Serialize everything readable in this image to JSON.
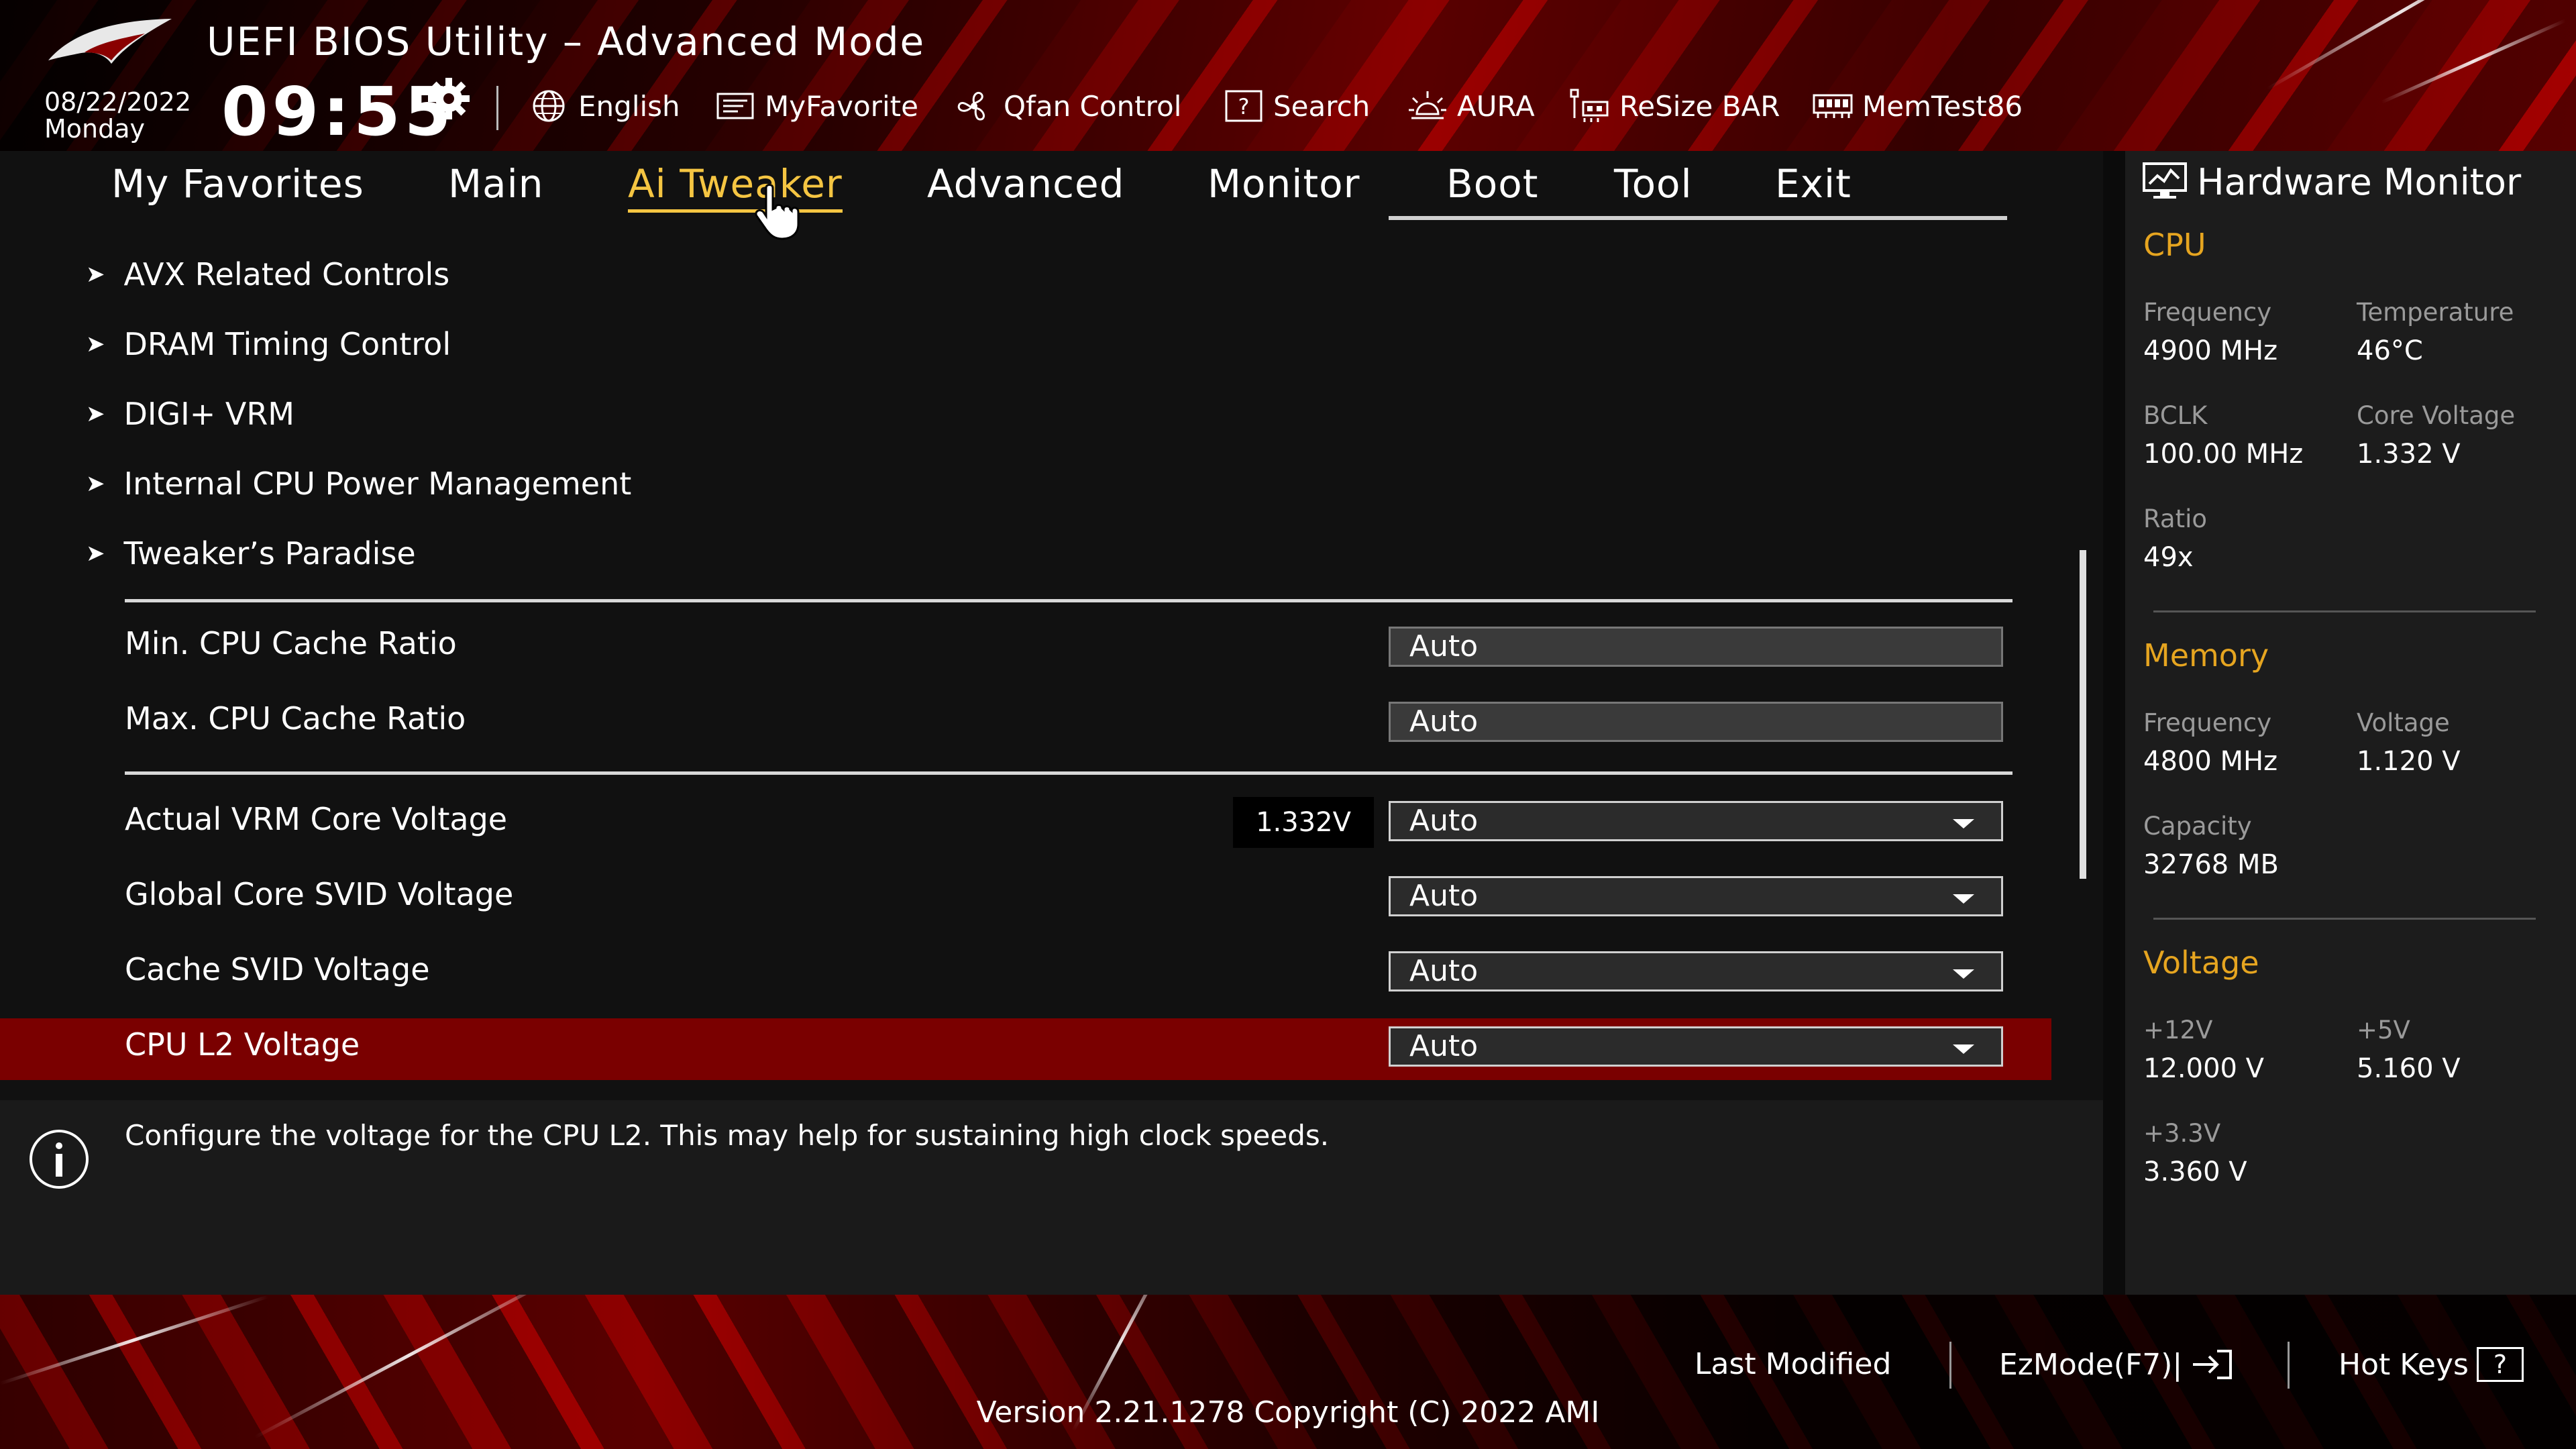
{
  "header": {
    "title": "UEFI BIOS Utility – Advanced Mode",
    "date": "08/22/2022",
    "day": "Monday",
    "time": "09:55",
    "tools": [
      {
        "label": "English",
        "icon": "globe-icon"
      },
      {
        "label": "MyFavorite",
        "icon": "favorite-icon"
      },
      {
        "label": "Qfan Control",
        "icon": "fan-icon"
      },
      {
        "label": "Search",
        "icon": "search-icon"
      },
      {
        "label": "AURA",
        "icon": "aura-icon"
      },
      {
        "label": "ReSize BAR",
        "icon": "resize-bar-icon"
      },
      {
        "label": "MemTest86",
        "icon": "memtest-icon"
      }
    ]
  },
  "nav": {
    "tabs": [
      {
        "label": "My Favorites"
      },
      {
        "label": "Main"
      },
      {
        "label": "Ai Tweaker"
      },
      {
        "label": "Advanced"
      },
      {
        "label": "Monitor"
      },
      {
        "label": "Boot"
      },
      {
        "label": "Tool"
      },
      {
        "label": "Exit"
      }
    ],
    "active": "Ai Tweaker"
  },
  "main": {
    "submenus": [
      {
        "label": "AVX Related Controls"
      },
      {
        "label": "DRAM Timing Control"
      },
      {
        "label": "DIGI+ VRM"
      },
      {
        "label": "Internal CPU Power Management"
      },
      {
        "label": "Tweaker’s Paradise"
      }
    ],
    "settings": [
      {
        "label": "Min. CPU Cache Ratio",
        "value": "Auto"
      },
      {
        "label": "Max. CPU Cache Ratio",
        "value": "Auto"
      },
      {
        "label": "Actual VRM Core Voltage",
        "value": "Auto",
        "readout": "1.332V"
      },
      {
        "label": "Global Core SVID Voltage",
        "value": "Auto"
      },
      {
        "label": "Cache SVID Voltage",
        "value": "Auto"
      },
      {
        "label": "CPU L2 Voltage",
        "value": "Auto"
      }
    ],
    "selected": "CPU L2 Voltage"
  },
  "info": {
    "text": "Configure the voltage for the CPU L2. This may help for sustaining high clock speeds."
  },
  "hw_monitor": {
    "title": "Hardware Monitor",
    "cpu": {
      "heading": "CPU",
      "frequency_label": "Frequency",
      "frequency": "4900 MHz",
      "temperature_label": "Temperature",
      "temperature": "46°C",
      "bclk_label": "BCLK",
      "bclk": "100.00 MHz",
      "core_voltage_label": "Core Voltage",
      "core_voltage": "1.332 V",
      "ratio_label": "Ratio",
      "ratio": "49x"
    },
    "memory": {
      "heading": "Memory",
      "frequency_label": "Frequency",
      "frequency": "4800 MHz",
      "voltage_label": "Voltage",
      "voltage": "1.120 V",
      "capacity_label": "Capacity",
      "capacity": "32768 MB"
    },
    "voltage": {
      "heading": "Voltage",
      "v12_label": "+12V",
      "v12": "12.000 V",
      "v5_label": "+5V",
      "v5": "5.160 V",
      "v33_label": "+3.3V",
      "v33": "3.360 V"
    }
  },
  "footer": {
    "last_modified": "Last Modified",
    "ezmode": "EzMode(F7)|",
    "hot_keys": "Hot Keys",
    "hot_keys_key": "?",
    "version": "Version 2.21.1278 Copyright (C) 2022 AMI"
  },
  "colors": {
    "accent": "#f5c542",
    "section": "#e6a520",
    "selected_row": "#7a0000"
  }
}
